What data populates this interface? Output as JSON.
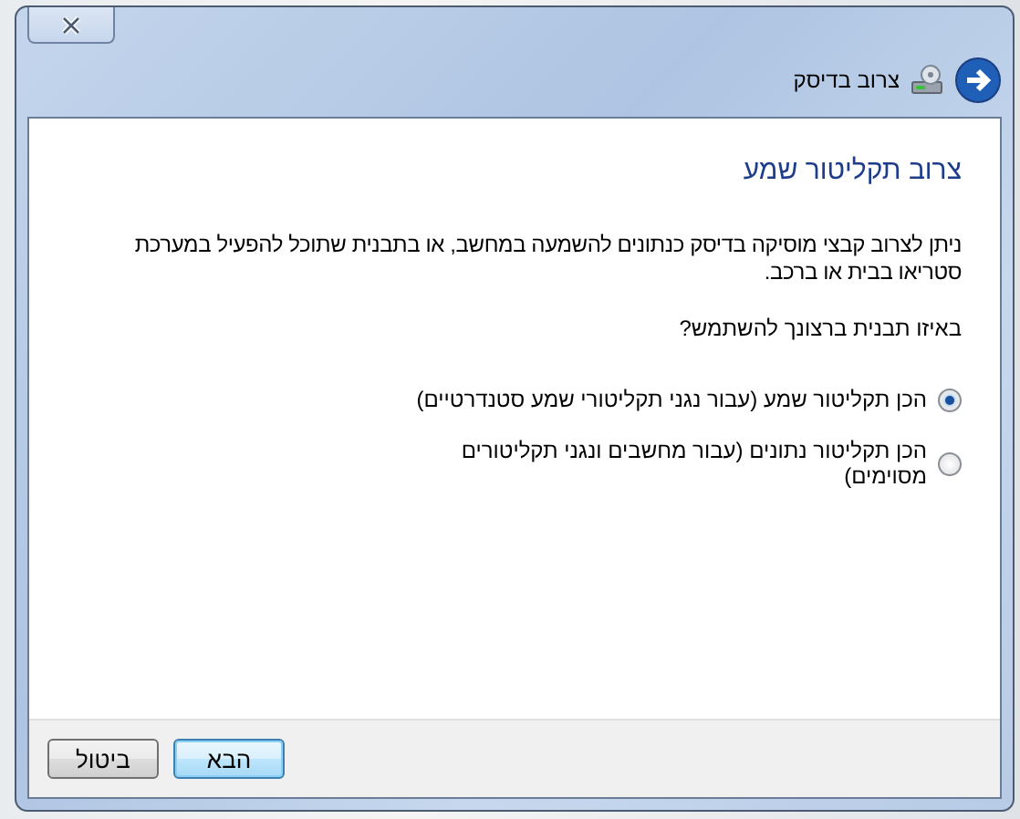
{
  "window": {
    "title": "צרוב בדיסק"
  },
  "page": {
    "heading": "צרוב תקליטור שמע",
    "description": "ניתן לצרוב קבצי מוסיקה בדיסק כנתונים להשמעה במחשב, או בתבנית שתוכל להפעיל במערכת סטריאו בבית או ברכב.",
    "question": "באיזו תבנית ברצונך להשתמש?",
    "options": [
      {
        "label": "הכן תקליטור שמע (עבור נגני תקליטורי שמע סטנדרטיים)",
        "selected": true
      },
      {
        "label": "הכן תקליטור נתונים (עבור מחשבים ונגני תקליטורים מסוימים)",
        "selected": false
      }
    ]
  },
  "buttons": [
    {
      "label": "הבא",
      "default": true
    },
    {
      "label": "ביטול",
      "default": false
    }
  ]
}
